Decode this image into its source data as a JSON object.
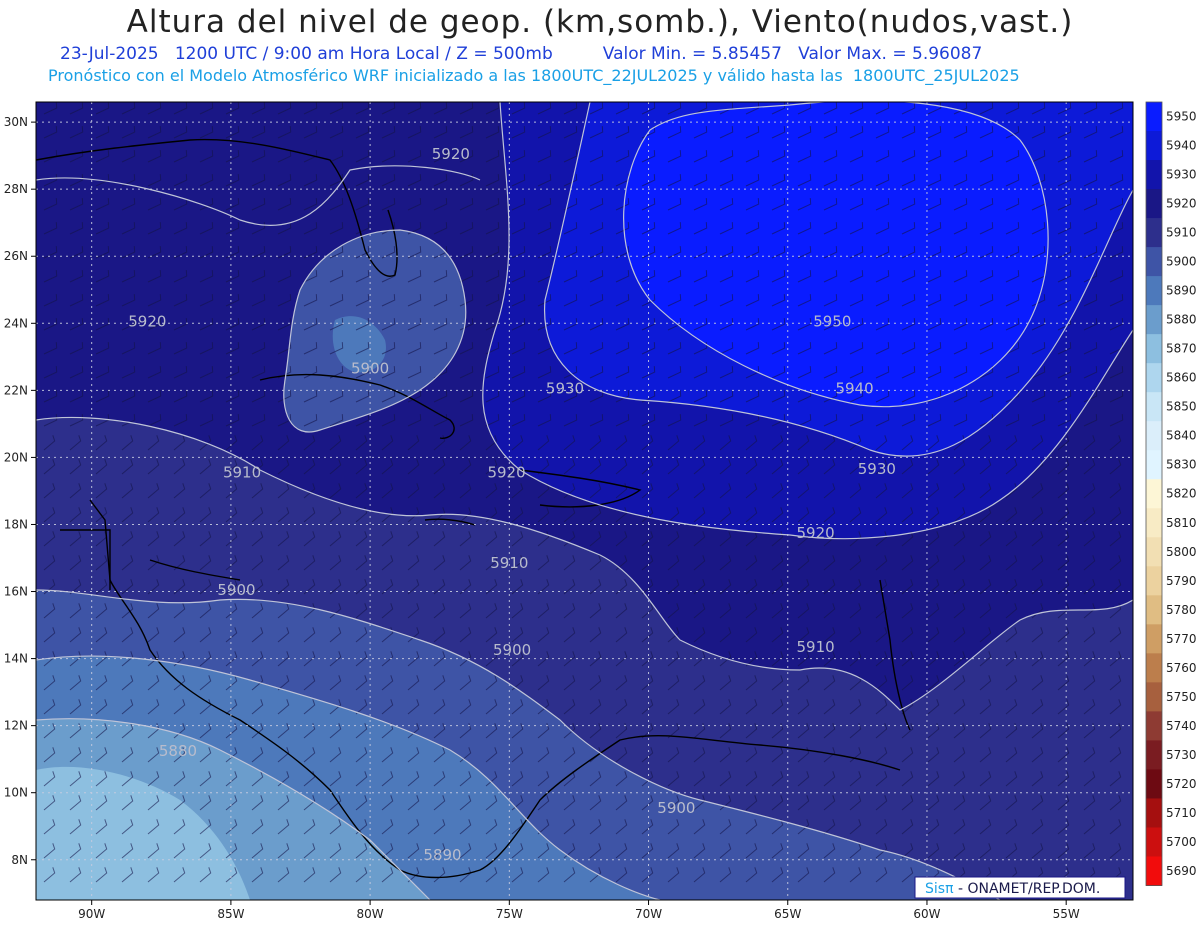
{
  "header": {
    "title": "Altura del nivel de geop. (km,somb.), Viento(nudos,vast.)",
    "subtitle_left": "23-Jul-2025   1200 UTC / 9:00 am Hora Local / Z = 500mb",
    "subtitle_right": "Valor Min. = 5.85457   Valor Max. = 5.96087",
    "line2": "Pronóstico con el Modelo Atmosférico WRF inicializado a las 1800UTC_22JUL2025 y válido hasta las  1800UTC_25JUL2025"
  },
  "map": {
    "lat_ticks": [
      "30N",
      "28N",
      "26N",
      "24N",
      "22N",
      "20N",
      "18N",
      "16N",
      "14N",
      "12N",
      "10N",
      "8N"
    ],
    "lon_ticks": [
      "90W",
      "85W",
      "80W",
      "75W",
      "70W",
      "65W",
      "60W",
      "55W"
    ],
    "contour_labels": [
      {
        "text": "5920",
        "lon": -77.1,
        "lat": 28.9
      },
      {
        "text": "5920",
        "lon": -88.0,
        "lat": 23.9
      },
      {
        "text": "5900",
        "lon": -80.0,
        "lat": 22.5
      },
      {
        "text": "5930",
        "lon": -73.0,
        "lat": 21.9
      },
      {
        "text": "5950",
        "lon": -63.4,
        "lat": 23.9
      },
      {
        "text": "5940",
        "lon": -62.6,
        "lat": 21.9
      },
      {
        "text": "5930",
        "lon": -61.8,
        "lat": 19.5
      },
      {
        "text": "5920",
        "lon": -75.1,
        "lat": 19.4
      },
      {
        "text": "5910",
        "lon": -84.6,
        "lat": 19.4
      },
      {
        "text": "5910",
        "lon": -75.0,
        "lat": 16.7
      },
      {
        "text": "5920",
        "lon": -64.0,
        "lat": 17.6
      },
      {
        "text": "5900",
        "lon": -84.8,
        "lat": 15.9
      },
      {
        "text": "5900",
        "lon": -74.9,
        "lat": 14.1
      },
      {
        "text": "5910",
        "lon": -64.0,
        "lat": 14.2
      },
      {
        "text": "5880",
        "lon": -86.9,
        "lat": 11.1
      },
      {
        "text": "5900",
        "lon": -69.0,
        "lat": 9.4
      },
      {
        "text": "5890",
        "lon": -77.4,
        "lat": 8.0
      }
    ]
  },
  "legend": {
    "levels": [
      "5950",
      "5940",
      "5930",
      "5920",
      "5910",
      "5900",
      "5890",
      "5880",
      "5870",
      "5860",
      "5850",
      "5840",
      "5830",
      "5820",
      "5810",
      "5800",
      "5790",
      "5780",
      "5770",
      "5760",
      "5750",
      "5740",
      "5730",
      "5720",
      "5710",
      "5700",
      "5690"
    ],
    "colors": [
      "#0a1cff",
      "#0d1ad8",
      "#1214ab",
      "#1a1786",
      "#2d2f8c",
      "#3e54a6",
      "#4d79bb",
      "#6b9dcc",
      "#8dbfe0",
      "#aed6ee",
      "#c9e6f6",
      "#dbeefa",
      "#e0f4ff",
      "#fdf6d6",
      "#f8ebc5",
      "#f2dfb3",
      "#ecd29f",
      "#e0bd83",
      "#cf9e64",
      "#bc7e4c",
      "#a7603e",
      "#8e3b33",
      "#7a1c21",
      "#6d0a12",
      "#a50f0f",
      "#cc0f0f",
      "#f20c0c"
    ]
  },
  "credit": {
    "brand": "Sisπ",
    "org": " - ONAMET/REP.DOM."
  }
}
